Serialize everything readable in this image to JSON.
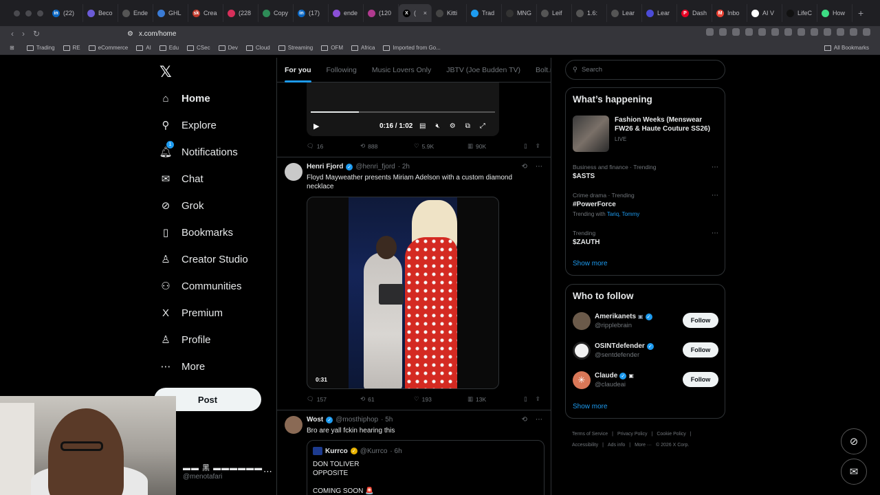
{
  "browser": {
    "tabs": [
      {
        "label": "(22)",
        "color": "#0a66c2",
        "glyph": "in"
      },
      {
        "label": "Beco",
        "color": "#6b5bd6",
        "glyph": ""
      },
      {
        "label": "Ende",
        "color": "#555555",
        "glyph": ""
      },
      {
        "label": "GHL",
        "color": "#3a7bd5",
        "glyph": ""
      },
      {
        "label": "Crea",
        "color": "#c0392b",
        "glyph": "sk"
      },
      {
        "label": "(228",
        "color": "#d62f5a",
        "glyph": ""
      },
      {
        "label": "Copy",
        "color": "#2e8b57",
        "glyph": ""
      },
      {
        "label": "(17)",
        "color": "#0a66c2",
        "glyph": "in"
      },
      {
        "label": "ende",
        "color": "#8a4fd6",
        "glyph": ""
      },
      {
        "label": "(120",
        "color": "#b03a8f",
        "glyph": ""
      },
      {
        "label": "(",
        "color": "#000000",
        "glyph": "X",
        "active": true
      },
      {
        "label": "Kitti",
        "color": "#444444",
        "glyph": ""
      },
      {
        "label": "Trad",
        "color": "#1d9bf0",
        "glyph": ""
      },
      {
        "label": "MNG",
        "color": "#333333",
        "glyph": ""
      },
      {
        "label": "Leif",
        "color": "#555555",
        "glyph": ""
      },
      {
        "label": "1.6:",
        "color": "#555555",
        "glyph": ""
      },
      {
        "label": "Lear",
        "color": "#555555",
        "glyph": ""
      },
      {
        "label": "Lear",
        "color": "#4b4bd6",
        "glyph": ""
      },
      {
        "label": "Dash",
        "color": "#e60023",
        "glyph": "P"
      },
      {
        "label": "Inbo",
        "color": "#ea4335",
        "glyph": "M"
      },
      {
        "label": "AI V",
        "color": "#ffffff",
        "glyph": ""
      },
      {
        "label": "LifeC",
        "color": "#111111",
        "glyph": ""
      },
      {
        "label": "How",
        "color": "#3ddc84",
        "glyph": ""
      }
    ],
    "url": "x.com/home",
    "bookmarks": [
      "Trading",
      "RE",
      "eCommerce",
      "AI",
      "Edu",
      "CSec",
      "Dev",
      "Cloud",
      "Streaming",
      "OFM",
      "Africa",
      "Imported from Go..."
    ],
    "all_bookmarks": "All Bookmarks"
  },
  "nav": {
    "items": [
      {
        "label": "Home",
        "icon": "home-icon",
        "glyph": "⌂"
      },
      {
        "label": "Explore",
        "icon": "search-icon",
        "glyph": "⚲"
      },
      {
        "label": "Notifications",
        "icon": "bell-icon",
        "glyph": "🔔︎"
      },
      {
        "label": "Chat",
        "icon": "mail-icon",
        "glyph": "✉"
      },
      {
        "label": "Grok",
        "icon": "grok-icon",
        "glyph": "⊘"
      },
      {
        "label": "Bookmarks",
        "icon": "bookmark-icon",
        "glyph": "▯"
      },
      {
        "label": "Creator Studio",
        "icon": "creator-studio-icon",
        "glyph": "♙"
      },
      {
        "label": "Communities",
        "icon": "communities-icon",
        "glyph": "⚇"
      },
      {
        "label": "Premium",
        "icon": "x-premium-icon",
        "glyph": "X"
      },
      {
        "label": "Profile",
        "icon": "profile-icon",
        "glyph": "♙"
      },
      {
        "label": "More",
        "icon": "more-icon",
        "glyph": "⋯"
      }
    ],
    "notifications_badge": "1",
    "post_label": "Post",
    "account_name": "▬▬ 黑 ▬▬▬▬▬▬",
    "account_handle": "@menotafari"
  },
  "feed": {
    "tabs": [
      "For you",
      "Following",
      "Music Lovers Only",
      "JBTV (Joe Budden TV)",
      "Bolt.new"
    ],
    "video1": {
      "time": "0:16 / 1:02",
      "replies": "16",
      "reposts": "888",
      "likes": "5.9K",
      "views": "90K"
    },
    "tweet2": {
      "name": "Henri Fjord",
      "handle": "@henri_fjord",
      "time": "· 2h",
      "text": "Floyd Mayweather presents Miriam Adelson with a custom diamond necklace",
      "duration": "0:31",
      "replies": "157",
      "reposts": "61",
      "likes": "193",
      "views": "13K"
    },
    "tweet3": {
      "name": "Wost",
      "handle": "@mosthiphop",
      "time": "· 5h",
      "text": "Bro are yall fckin hearing this",
      "quote_name": "Kurrco",
      "quote_handle": "@Kurrco",
      "quote_time": "· 6h",
      "quote_text": "DON TOLIVER\nOPPOSITE\n\nCOMING SOON 🚨"
    }
  },
  "sidebar": {
    "search_placeholder": "Search",
    "happening_title": "What’s happening",
    "top_trend": {
      "title": "Fashion Weeks (Menswear FW26 & Haute Couture SS26)",
      "status": "LIVE"
    },
    "trends": [
      {
        "context": "Business and finance · Trending",
        "name": "$ASTS",
        "with": ""
      },
      {
        "context": "Crime drama · Trending",
        "name": "#PowerForce",
        "with_prefix": "Trending with",
        "with": "Tariq, Tommy"
      },
      {
        "context": "Trending",
        "name": "$ZAUTH",
        "with": ""
      }
    ],
    "show_more": "Show more",
    "wtf_title": "Who to follow",
    "follow_label": "Follow",
    "suggestions": [
      {
        "name": "Amerikanets",
        "handle": "@ripplebrain",
        "avatar_color": "#6b5a4a"
      },
      {
        "name": "OSINTdefender",
        "handle": "@sentdefender",
        "avatar_color": "#f2f2f2"
      },
      {
        "name": "Claude",
        "handle": "@claudeai",
        "avatar_color": "#d97757"
      }
    ],
    "footer": [
      "Terms of Service",
      "|",
      "Privacy Policy",
      "|",
      "Cookie Policy",
      "|",
      "Accessibility",
      "|",
      "Ads info",
      "|",
      "More ···",
      "© 2026 X Corp."
    ]
  }
}
